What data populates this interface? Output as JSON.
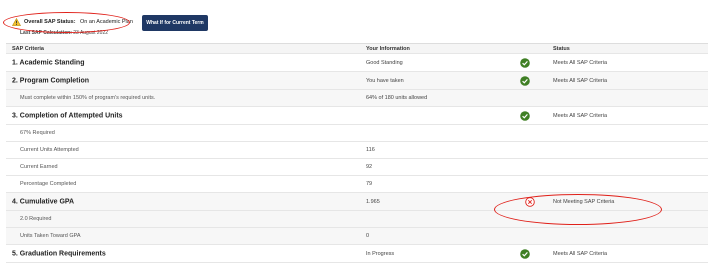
{
  "status": {
    "label": "Overall SAP Status:",
    "value": "On an Academic Plan",
    "whatif_button": "What If for Current Term",
    "last_calc_label": "Last SAP Calculation:",
    "last_calc_value": "23 August 2022"
  },
  "table": {
    "headers": {
      "criteria": "SAP Criteria",
      "info": "Your Information",
      "status": "Status"
    },
    "rows": [
      {
        "criteria": "1. Academic Standing",
        "info": "Good Standing",
        "status": "Meets All SAP Criteria"
      },
      {
        "criteria": "2. Program Completion",
        "info": "You have taken",
        "status": "Meets All SAP Criteria"
      },
      {
        "criteria": "Must complete within 150% of program's required units.",
        "info": "64% of 180 units allowed",
        "status": ""
      },
      {
        "criteria": "3. Completion of Attempted Units",
        "info": "",
        "status": "Meets All SAP Criteria"
      },
      {
        "criteria": "67% Required",
        "info": "",
        "status": ""
      },
      {
        "criteria": "Current Units Attempted",
        "info": "116",
        "status": ""
      },
      {
        "criteria": "Current Earned",
        "info": "92",
        "status": ""
      },
      {
        "criteria": "Percentage Completed",
        "info": "79",
        "status": ""
      },
      {
        "criteria": "4. Cumulative GPA",
        "info": "1.965",
        "status": "Not Meeting SAP Criteria"
      },
      {
        "criteria": "2.0 Required",
        "info": "",
        "status": ""
      },
      {
        "criteria": "Units Taken Toward GPA",
        "info": "0",
        "status": ""
      },
      {
        "criteria": "5. Graduation Requirements",
        "info": "In Progress",
        "status": "Meets All SAP Criteria"
      }
    ]
  },
  "icons": {
    "warning": "warning-icon",
    "met": "check-circle-icon",
    "not_met": "x-circle-icon"
  },
  "colors": {
    "button_bg": "#1f3864",
    "check_green": "#3f7f24",
    "error_red": "#e0211a",
    "warning_yellow": "#f2c230"
  }
}
